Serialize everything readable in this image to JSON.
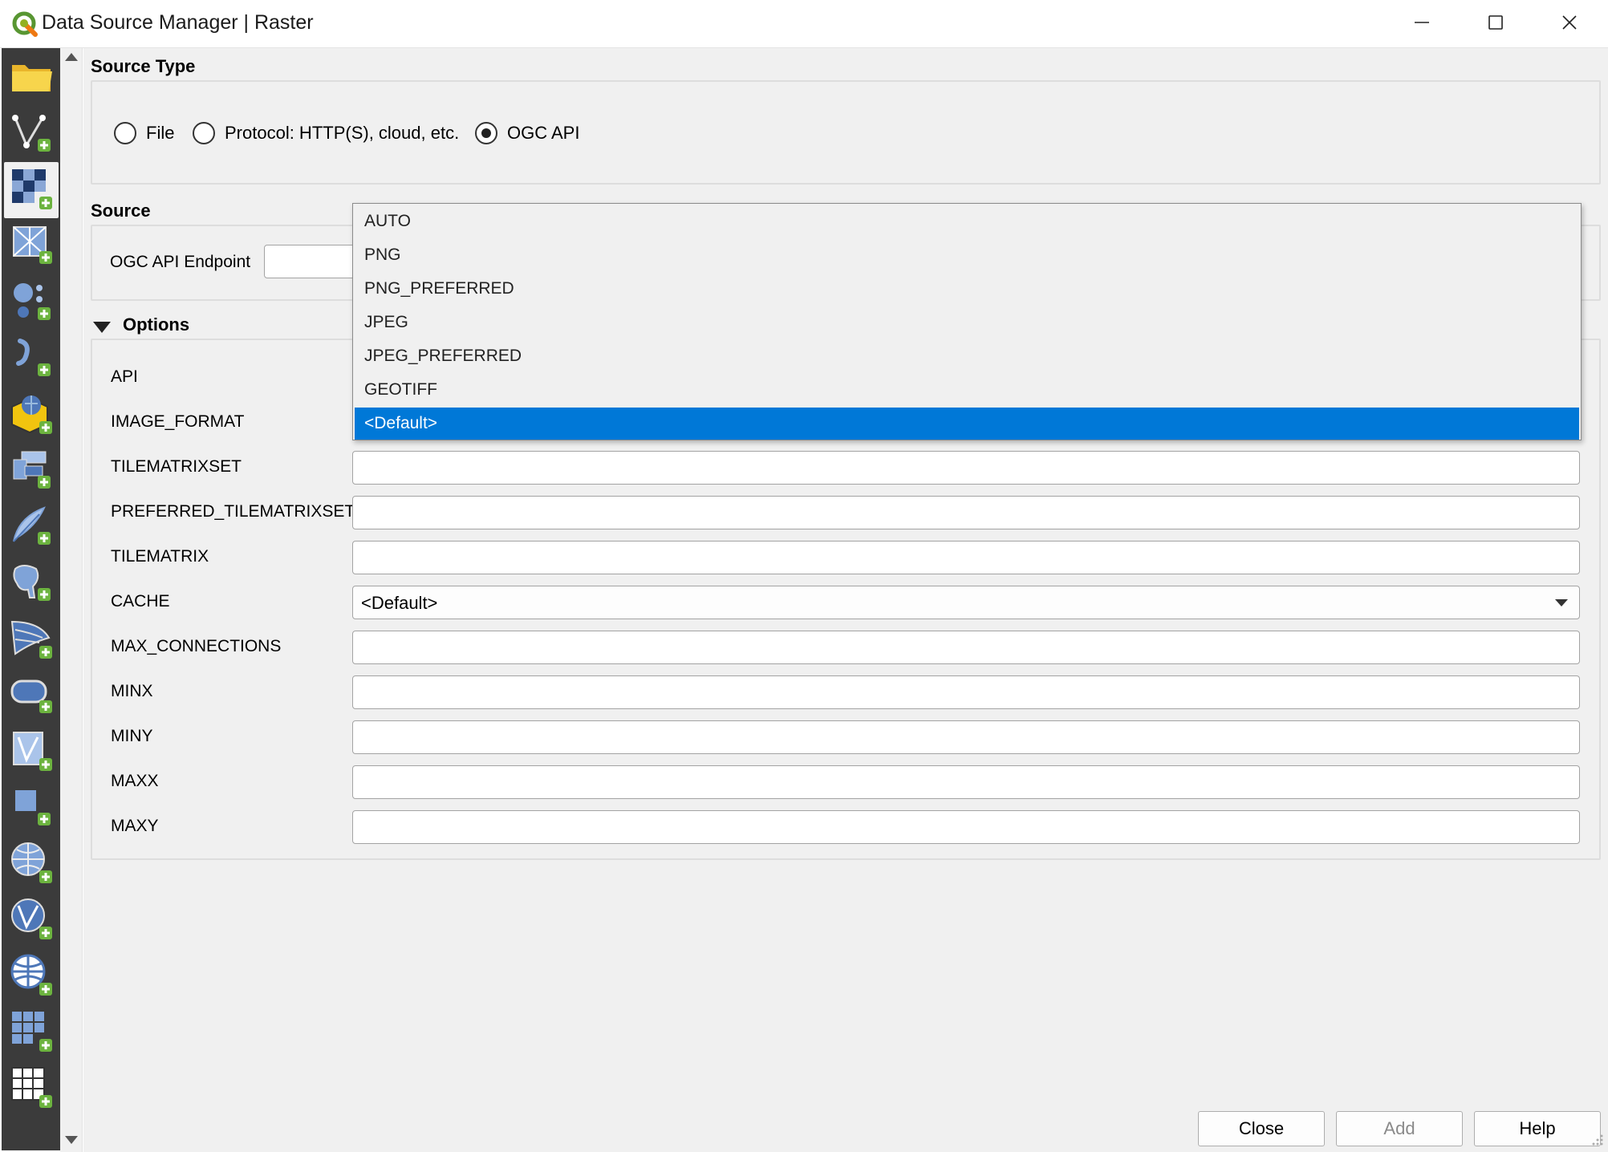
{
  "window": {
    "title": "Data Source Manager | Raster",
    "controls": {
      "minimize": "minimize-icon",
      "maximize": "maximize-icon",
      "close": "close-icon"
    }
  },
  "sidebar": {
    "items": [
      {
        "icon": "folder-icon"
      },
      {
        "icon": "add-vector-layer-icon"
      },
      {
        "icon": "add-raster-layer-icon",
        "active": true
      },
      {
        "icon": "add-mesh-layer-icon"
      },
      {
        "icon": "add-point-cloud-layer-icon"
      },
      {
        "icon": "add-delimited-text-layer-icon"
      },
      {
        "icon": "add-geopackage-layer-icon"
      },
      {
        "icon": "add-virtual-layer-icon"
      },
      {
        "icon": "add-spatialite-layer-icon"
      },
      {
        "icon": "add-postgis-layer-icon"
      },
      {
        "icon": "add-mssql-layer-icon"
      },
      {
        "icon": "add-oracle-layer-icon"
      },
      {
        "icon": "add-virtual-layer-2-icon"
      },
      {
        "icon": "add-vector-tile-layer-icon"
      },
      {
        "icon": "add-wms-wmts-layer-icon"
      },
      {
        "icon": "add-wfs-layer-icon"
      },
      {
        "icon": "add-ogc-api-features-icon"
      },
      {
        "icon": "add-xyz-layer-icon"
      },
      {
        "icon": "add-arcgis-layer-icon"
      }
    ]
  },
  "source_type": {
    "title": "Source Type",
    "options": [
      {
        "label": "File",
        "checked": false
      },
      {
        "label": "Protocol: HTTP(S), cloud, etc.",
        "checked": false
      },
      {
        "label": "OGC API",
        "checked": true
      }
    ]
  },
  "source": {
    "title": "Source",
    "endpoint_label": "OGC API Endpoint",
    "endpoint_value": ""
  },
  "options": {
    "title": "Options",
    "fields": [
      {
        "label": "API"
      },
      {
        "label": "IMAGE_FORMAT"
      },
      {
        "label": "TILEMATRIXSET",
        "value": ""
      },
      {
        "label": "PREFERRED_TILEMATRIXSET",
        "value": ""
      },
      {
        "label": "TILEMATRIX",
        "value": ""
      },
      {
        "label": "CACHE",
        "value": "<Default>"
      },
      {
        "label": "MAX_CONNECTIONS",
        "value": ""
      },
      {
        "label": "MINX",
        "value": ""
      },
      {
        "label": "MINY",
        "value": ""
      },
      {
        "label": "MAXX",
        "value": ""
      },
      {
        "label": "MAXY",
        "value": ""
      }
    ]
  },
  "dropdown": {
    "items": [
      "AUTO",
      "PNG",
      "PNG_PREFERRED",
      "JPEG",
      "JPEG_PREFERRED",
      "GEOTIFF",
      "<Default>"
    ],
    "selected_index": 6
  },
  "buttons": {
    "close": "Close",
    "add": "Add",
    "help": "Help"
  },
  "colors": {
    "selection": "#0078d7",
    "sidebar_bg": "#3b3b3b",
    "panel_bg": "#f0f0f0"
  }
}
